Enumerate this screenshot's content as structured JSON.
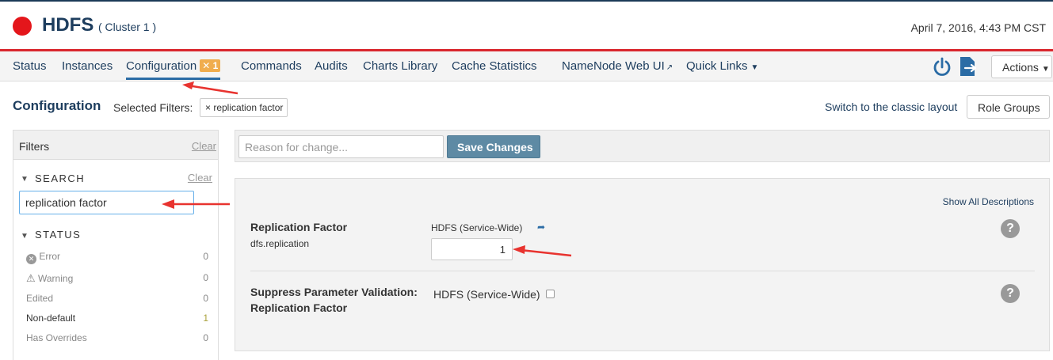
{
  "header": {
    "title": "HDFS",
    "cluster": "( Cluster 1 )",
    "timestamp": "April 7, 2016, 4:43 PM CST",
    "status_color": "#e4161b"
  },
  "nav": {
    "tabs": [
      {
        "label": "Status"
      },
      {
        "label": "Instances"
      },
      {
        "label": "Configuration",
        "badge": "1",
        "active": true
      },
      {
        "label": "Commands"
      },
      {
        "label": "Audits"
      },
      {
        "label": "Charts Library"
      },
      {
        "label": "Cache Statistics"
      },
      {
        "label": "NameNode Web UI"
      },
      {
        "label": "Quick Links"
      }
    ],
    "actions_label": "Actions"
  },
  "toolbar": {
    "title": "Configuration",
    "selected_filters_label": "Selected Filters:",
    "filter_chip": "× replication factor",
    "classic_layout_link": "Switch to the classic layout",
    "role_groups_label": "Role Groups"
  },
  "sidebar": {
    "title": "Filters",
    "clear_label": "Clear",
    "search_heading": "SEARCH",
    "search_clear": "Clear",
    "search_value": "replication factor",
    "status_heading": "STATUS",
    "status_items": [
      {
        "label": "Error",
        "count": "0"
      },
      {
        "label": "Warning",
        "count": "0"
      },
      {
        "label": "Edited",
        "count": "0"
      },
      {
        "label": "Non-default",
        "count": "1"
      },
      {
        "label": "Has Overrides",
        "count": "0"
      }
    ]
  },
  "main": {
    "reason_placeholder": "Reason for change...",
    "save_label": "Save Changes",
    "show_descriptions": "Show All Descriptions",
    "properties": [
      {
        "name": "Replication Factor",
        "key": "dfs.replication",
        "scope": "HDFS (Service-Wide)",
        "value": "1"
      },
      {
        "name_line1": "Suppress Parameter Validation:",
        "name_line2": "Replication Factor",
        "scope": "HDFS (Service-Wide)"
      }
    ]
  },
  "colors": {
    "accent_navy": "#1d3d5e",
    "red_bar": "#d9262d",
    "save_button": "#5e8aa4",
    "badge": "#f0ad4e",
    "annotation_arrow": "#e8332f"
  }
}
